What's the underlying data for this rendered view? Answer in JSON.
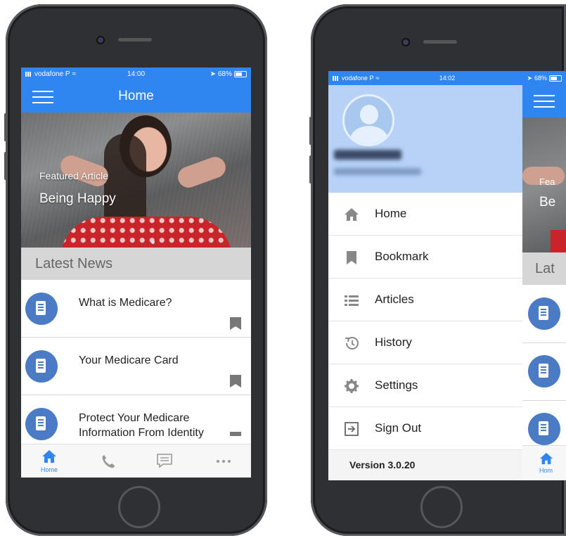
{
  "left_phone": {
    "status": {
      "carrier": "vodafone P",
      "time": "14:00",
      "battery": "68%"
    },
    "header": {
      "title": "Home"
    },
    "featured": {
      "kicker": "Featured Article",
      "title": "Being Happy"
    },
    "section_title": "Latest News",
    "news": [
      {
        "title": "What is Medicare?"
      },
      {
        "title": "Your Medicare Card"
      },
      {
        "title": "Protect Your Medicare Information From Identity"
      }
    ],
    "tabs": [
      {
        "label": "Home",
        "icon": "home-icon"
      },
      {
        "label": "",
        "icon": "phone-icon"
      },
      {
        "label": "",
        "icon": "chat-icon"
      },
      {
        "label": "",
        "icon": "more-icon"
      }
    ]
  },
  "right_phone": {
    "status": {
      "carrier": "vodafone P",
      "time": "14:02",
      "battery": "68%"
    },
    "menu": [
      {
        "label": "Home",
        "icon": "home-icon"
      },
      {
        "label": "Bookmark",
        "icon": "bookmark-icon"
      },
      {
        "label": "Articles",
        "icon": "list-icon"
      },
      {
        "label": "History",
        "icon": "history-icon"
      },
      {
        "label": "Settings",
        "icon": "gear-icon"
      },
      {
        "label": "Sign Out",
        "icon": "sign-out-icon"
      }
    ],
    "version": "Version 3.0.20",
    "behind": {
      "hero_kicker": "Fea",
      "hero_title": "Be",
      "section": "Lat",
      "tab_label": "Hom"
    }
  },
  "colors": {
    "accent": "#2f86f0",
    "drawer_header": "#b7d2f6",
    "doc_icon": "#4a7bc4"
  }
}
